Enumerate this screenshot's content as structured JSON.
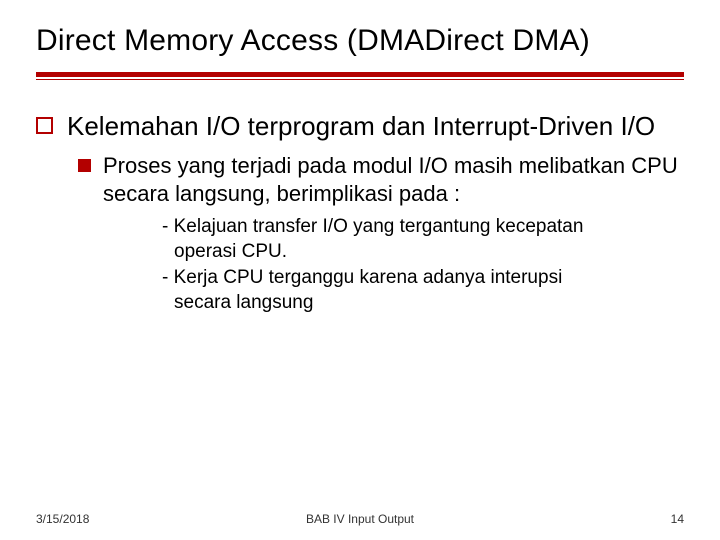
{
  "title": "Direct Memory Access (DMADirect DMA)",
  "bullet1": "Kelemahan I/O terprogram dan Interrupt-Driven I/O",
  "bullet2": "Proses yang terjadi pada modul I/O masih melibatkan CPU secara langsung, berimplikasi pada :",
  "sub1": "- Kelajuan transfer I/O yang tergantung kecepatan operasi CPU.",
  "sub2": "- Kerja CPU terganggu karena adanya interupsi secara langsung",
  "footer": {
    "date": "3/15/2018",
    "center": "BAB IV   Input Output",
    "page": "14"
  }
}
